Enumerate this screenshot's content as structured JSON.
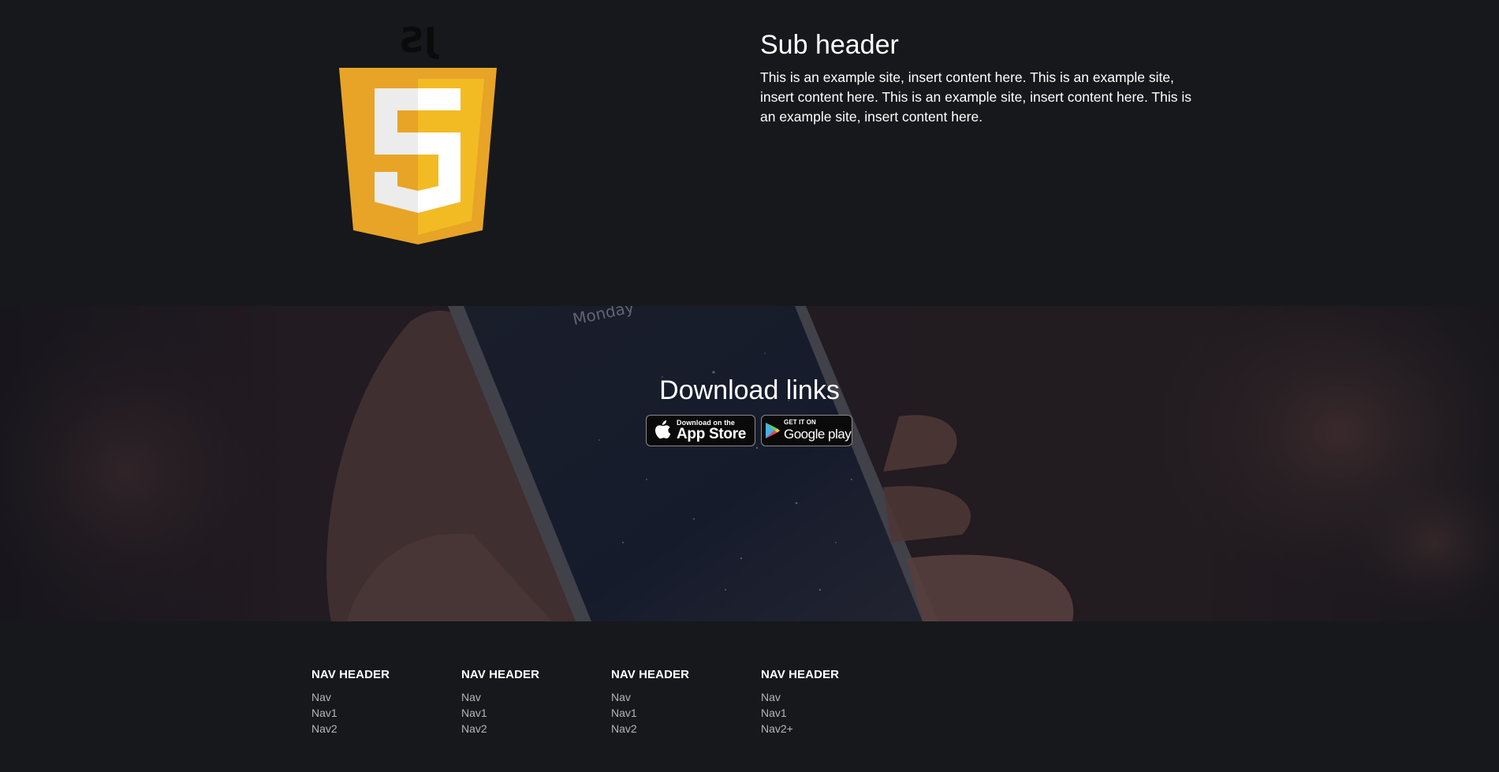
{
  "top": {
    "logo_text": "JS",
    "logo_number": "5",
    "sub_header": "Sub header",
    "body": "This is an example site, insert content here. This is an example site, insert content here. This is an example site, insert content here. This is an example site, insert content here."
  },
  "hero": {
    "title": "Download links",
    "phone_screen_text": "Monday",
    "app_store": {
      "small": "Download on the",
      "big": "App Store",
      "icon": "apple-icon"
    },
    "google_play": {
      "small": "GET IT ON",
      "big": "Google play",
      "icon": "play-triangle-icon"
    }
  },
  "footer": {
    "columns": [
      {
        "header": "NAV HEADER",
        "links": [
          "Nav",
          "Nav1",
          "Nav2"
        ]
      },
      {
        "header": "NAV HEADER",
        "links": [
          "Nav",
          "Nav1",
          "Nav2"
        ]
      },
      {
        "header": "NAV HEADER",
        "links": [
          "Nav",
          "Nav1",
          "Nav2"
        ]
      },
      {
        "header": "NAV HEADER",
        "links": [
          "Nav",
          "Nav1",
          "Nav2+"
        ]
      }
    ]
  },
  "colors": {
    "background": "#17181b",
    "logo_orange": "#e7a427",
    "logo_yellow": "#f2bb24",
    "text_muted": "#b3b5ba"
  }
}
